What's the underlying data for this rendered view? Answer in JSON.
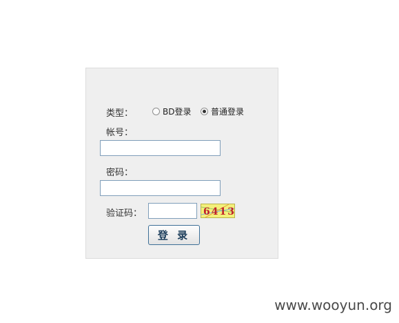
{
  "form": {
    "type_label": "类型：",
    "type_options": [
      {
        "label": "BD登录",
        "checked": false
      },
      {
        "label": "普通登录",
        "checked": true
      }
    ],
    "account_label": "帐号：",
    "account_value": "",
    "password_label": "密码：",
    "password_value": "",
    "captcha_label": "验证码：",
    "captcha_value": "",
    "captcha_text": "6413",
    "submit_label": "登 录"
  },
  "watermark": "www.wooyun.org",
  "colors": {
    "panel_bg": "#efefef",
    "input_border": "#7e9db9",
    "button_border": "#3c6e96",
    "captcha_bg": "#f3f07a",
    "captcha_digits": "#c0202a"
  }
}
